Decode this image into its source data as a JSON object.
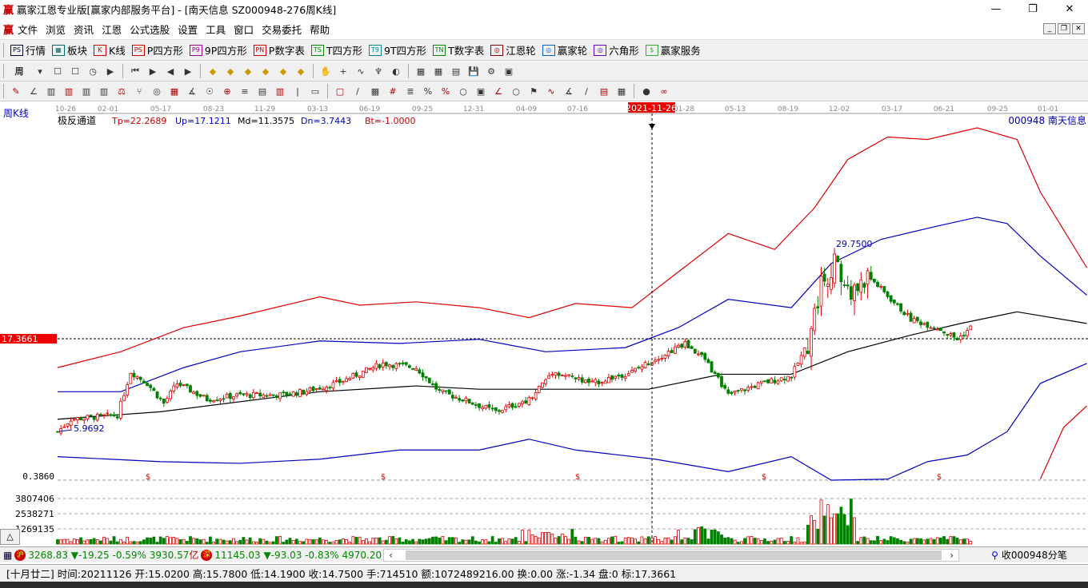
{
  "titlebar": {
    "logo": "赢",
    "title": "赢家江恩专业版[赢家内部服务平台] - [南天信息  SZ000948-276周K线]",
    "minimize": "—",
    "maximize": "❐",
    "close": "✕"
  },
  "menubar": {
    "logo": "赢",
    "items": [
      "文件",
      "浏览",
      "资讯",
      "江恩",
      "公式选股",
      "设置",
      "工具",
      "窗口",
      "交易委托",
      "帮助"
    ],
    "mdi": [
      "_",
      "❐",
      "✕"
    ]
  },
  "toolbar1": [
    {
      "icon": "PS",
      "label": "行情",
      "name": "quotes",
      "color": "#003"
    },
    {
      "icon": "▦",
      "label": "板块",
      "name": "sectors",
      "color": "#066"
    },
    {
      "icon": "K",
      "label": "K线",
      "name": "kline",
      "color": "#c00"
    },
    {
      "icon": "PS",
      "label": "P四方形",
      "name": "p-square",
      "color": "#c00"
    },
    {
      "icon": "P9",
      "label": "9P四方形",
      "name": "9p-square",
      "color": "#909"
    },
    {
      "icon": "PN",
      "label": "P数字表",
      "name": "p-number-table",
      "color": "#c00"
    },
    {
      "icon": "TS",
      "label": "T四方形",
      "name": "t-square",
      "color": "#080"
    },
    {
      "icon": "T9",
      "label": "9T四方形",
      "name": "9t-square",
      "color": "#088"
    },
    {
      "icon": "TN",
      "label": "T数字表",
      "name": "t-number-table",
      "color": "#080"
    },
    {
      "icon": "◎",
      "label": "江恩轮",
      "name": "gann-wheel",
      "color": "#800"
    },
    {
      "icon": "◎",
      "label": "赢家轮",
      "name": "winner-wheel",
      "color": "#06c"
    },
    {
      "icon": "◎",
      "label": "六角形",
      "name": "hexagon",
      "color": "#60c"
    },
    {
      "icon": "$",
      "label": "赢家服务",
      "name": "winner-service",
      "color": "#3a3"
    }
  ],
  "toolbar2_icons": [
    "period",
    "dropdown",
    "zoom-in",
    "zoom-out",
    "cursor",
    "first",
    "play",
    "left",
    "right",
    "diamond-1",
    "diamond-2",
    "diamond-3",
    "diamond-4",
    "diamond-5",
    "diamond-6",
    "hand",
    "crosshair",
    "wave",
    "tooth",
    "rainbow",
    "calendar",
    "calc",
    "print",
    "save",
    "settings",
    "export"
  ],
  "toolbar2_period": "周",
  "toolbar3_icons": [
    "pen",
    "angle",
    "grid-1",
    "grid-2",
    "grid-3",
    "grid-4",
    "scale",
    "fork",
    "circles",
    "bars",
    "fan",
    "spiral",
    "compass",
    "lines",
    "stairs",
    "stacks",
    "vertical",
    "rect",
    "square",
    "line",
    "table",
    "grid",
    "lines-2",
    "percent",
    "percent-2",
    "circle",
    "box",
    "angle-2",
    "ring",
    "flag",
    "wave2",
    "fan2",
    "tilt",
    "table-2",
    "fib",
    "pie",
    "infinity"
  ],
  "chart": {
    "period_label": "周K线",
    "indicator_name": "极反通道",
    "tp": "Tp=22.2689",
    "up": "Up=17.1211",
    "md": "Md=11.3575",
    "dn": "Dn=3.7443",
    "bt": "Bt=-1.0000",
    "stock_label": "000948  南天信息",
    "date_ticks": [
      "10-26",
      "02-01",
      "05-17",
      "08-23",
      "11-29",
      "03-13",
      "06-19",
      "09-25",
      "12-31",
      "04-09",
      "07-16",
      "10",
      "01-28",
      "05-13",
      "08-19",
      "12-02",
      "03-17",
      "06-21",
      "09-25",
      "01-01"
    ],
    "cursor_date": "2021-11-26",
    "cursor_price": "17.3661",
    "low_label": "5.9692",
    "high_label": "29.7500",
    "min_price_label": "0.3860",
    "volume_ticks": [
      "3807406",
      "2538271",
      "1269135"
    ],
    "colors": {
      "up": "#e00000",
      "down": "#008000",
      "upper_band": "#e00000",
      "mid_band": "#0000c0",
      "center": "#000000"
    }
  },
  "chart_data": {
    "type": "candlestick",
    "x_unit": "week index",
    "y_range": [
      0.386,
      42.7
    ],
    "close_anchors": [
      [
        0,
        6.2
      ],
      [
        4,
        7.7
      ],
      [
        18,
        8.2
      ],
      [
        22,
        13.4
      ],
      [
        27,
        12.0
      ],
      [
        32,
        9.6
      ],
      [
        36,
        12.0
      ],
      [
        45,
        10.1
      ],
      [
        55,
        10.6
      ],
      [
        67,
        10.6
      ],
      [
        74,
        11.0
      ],
      [
        84,
        12.0
      ],
      [
        98,
        14.4
      ],
      [
        108,
        13.9
      ],
      [
        115,
        11.0
      ],
      [
        122,
        10.1
      ],
      [
        132,
        8.6
      ],
      [
        142,
        10.1
      ],
      [
        149,
        13.4
      ],
      [
        161,
        12.0
      ],
      [
        173,
        13.4
      ],
      [
        179,
        14.75
      ],
      [
        189,
        16.8
      ],
      [
        195,
        14.9
      ],
      [
        202,
        10.6
      ],
      [
        212,
        12.0
      ],
      [
        221,
        12.9
      ],
      [
        226,
        16.8
      ],
      [
        230,
        24.0
      ],
      [
        234,
        26.4
      ],
      [
        239,
        22.5
      ],
      [
        244,
        25.0
      ],
      [
        250,
        22.5
      ],
      [
        257,
        19.7
      ],
      [
        265,
        18.7
      ],
      [
        271,
        17.3
      ],
      [
        275,
        18.7
      ]
    ],
    "upper_red": [
      [
        0,
        13.9
      ],
      [
        19,
        15.8
      ],
      [
        38,
        18.7
      ],
      [
        55,
        20.1
      ],
      [
        79,
        22.4
      ],
      [
        91,
        21.4
      ],
      [
        108,
        21.8
      ],
      [
        127,
        21.1
      ],
      [
        142,
        19.9
      ],
      [
        156,
        21.6
      ],
      [
        173,
        21.1
      ],
      [
        187,
        25.4
      ],
      [
        202,
        30.0
      ],
      [
        216,
        28.1
      ],
      [
        228,
        33.1
      ],
      [
        238,
        38.9
      ],
      [
        250,
        41.6
      ],
      [
        262,
        41.3
      ],
      [
        277,
        42.7
      ],
      [
        289,
        41.3
      ],
      [
        296,
        35.0
      ],
      [
        310,
        25.9
      ]
    ],
    "upper_blue": [
      [
        0,
        11.0
      ],
      [
        19,
        11.0
      ],
      [
        38,
        13.9
      ],
      [
        55,
        15.8
      ],
      [
        79,
        17.1
      ],
      [
        103,
        16.8
      ],
      [
        127,
        17.3
      ],
      [
        147,
        15.8
      ],
      [
        171,
        16.3
      ],
      [
        187,
        18.7
      ],
      [
        202,
        22.1
      ],
      [
        221,
        21.1
      ],
      [
        233,
        26.4
      ],
      [
        248,
        29.3
      ],
      [
        265,
        30.9
      ],
      [
        277,
        31.96
      ],
      [
        286,
        31.2
      ],
      [
        296,
        27.3
      ],
      [
        310,
        22.6
      ]
    ],
    "center": [
      [
        0,
        7.7
      ],
      [
        31,
        8.6
      ],
      [
        79,
        11.0
      ],
      [
        108,
        11.7
      ],
      [
        127,
        11.3
      ],
      [
        151,
        11.3
      ],
      [
        178,
        11.3
      ],
      [
        200,
        13.1
      ],
      [
        221,
        13.1
      ],
      [
        238,
        15.8
      ],
      [
        257,
        17.8
      ],
      [
        272,
        19.2
      ],
      [
        289,
        20.6
      ],
      [
        310,
        19.2
      ]
    ],
    "lower_blue": [
      [
        0,
        3.2
      ],
      [
        31,
        2.6
      ],
      [
        55,
        2.4
      ],
      [
        79,
        2.9
      ],
      [
        103,
        4.0
      ],
      [
        127,
        4.0
      ],
      [
        142,
        5.3
      ],
      [
        156,
        4.0
      ],
      [
        180,
        2.9
      ],
      [
        202,
        1.4
      ],
      [
        221,
        3.2
      ],
      [
        233,
        0.3
      ],
      [
        250,
        0.5
      ],
      [
        262,
        2.6
      ],
      [
        274,
        3.4
      ],
      [
        286,
        6.2
      ],
      [
        296,
        12.0
      ],
      [
        310,
        14.4
      ]
    ],
    "lower_red": [
      [
        296,
        0.5
      ],
      [
        303,
        6.7
      ],
      [
        310,
        9.3
      ]
    ],
    "volume_ticks": [
      1269135,
      2538271,
      3807406
    ]
  },
  "status1": {
    "sh_badge": "沪",
    "sh": "3268.83 ▼-19.25 -0.59% 3930.57",
    "sh_unit": "亿",
    "sz_badge": "深",
    "sz": "11145.03 ▼-93.03 -0.83% 4970.20",
    "scroll_left": "‹",
    "scroll_right": "›",
    "feed": "收000948分笔"
  },
  "status2": {
    "info": "[十月廿二] 时间:20211126 开:15.0200 高:15.7800 低:14.1900 收:14.7500 手:714510 额:1072489216.00 换:0.00 涨:-1.34 盘:0 标:17.3661"
  },
  "collapse_button": "△"
}
